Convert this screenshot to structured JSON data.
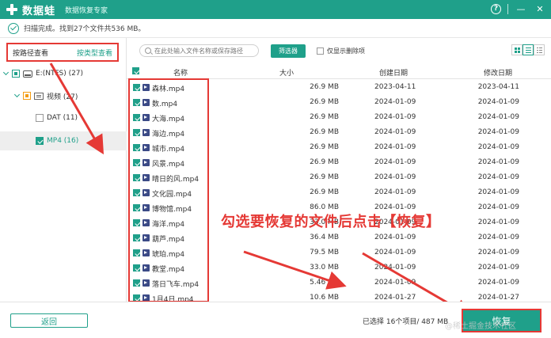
{
  "app": {
    "brand": "数据蛙",
    "subtitle": "数据恢复专家",
    "help_label": "?",
    "minimize_label": "—",
    "close_label": "✕"
  },
  "status": {
    "text": "扫描完成。找到27个文件共536 MB。"
  },
  "view_tabs": {
    "by_path": "按路径查看",
    "by_type": "按类型查看"
  },
  "tree": [
    {
      "label": "E:(NTFS) (27)"
    },
    {
      "label": "视频 (27)"
    },
    {
      "label": "DAT (11)"
    },
    {
      "label": "MP4 (16)"
    }
  ],
  "toolbar": {
    "search_placeholder": "在此处输入文件名称或保存路径",
    "filter_label": "筛选器",
    "only_deleted_label": "仅显示删除项"
  },
  "columns": {
    "name": "名称",
    "size": "大小",
    "created": "创建日期",
    "modified": "修改日期"
  },
  "files": [
    {
      "name": "森林.mp4",
      "size": "26.9 MB",
      "created": "2023-04-11",
      "modified": "2023-04-11"
    },
    {
      "name": "数.mp4",
      "size": "26.9 MB",
      "created": "2024-01-09",
      "modified": "2024-01-09"
    },
    {
      "name": "大海.mp4",
      "size": "26.9 MB",
      "created": "2024-01-09",
      "modified": "2024-01-09"
    },
    {
      "name": "海边.mp4",
      "size": "26.9 MB",
      "created": "2024-01-09",
      "modified": "2024-01-09"
    },
    {
      "name": "城市.mp4",
      "size": "26.9 MB",
      "created": "2024-01-09",
      "modified": "2024-01-09"
    },
    {
      "name": "风景.mp4",
      "size": "26.9 MB",
      "created": "2024-01-09",
      "modified": "2024-01-09"
    },
    {
      "name": "晴日的风.mp4",
      "size": "26.9 MB",
      "created": "2024-01-09",
      "modified": "2024-01-09"
    },
    {
      "name": "文化园.mp4",
      "size": "26.9 MB",
      "created": "2024-01-09",
      "modified": "2024-01-09"
    },
    {
      "name": "博物馆.mp4",
      "size": "86.0 MB",
      "created": "2024-01-09",
      "modified": "2024-01-09"
    },
    {
      "name": "海洋.mp4",
      "size": "33.0 MB",
      "created": "2024-01-09",
      "modified": "2024-01-09"
    },
    {
      "name": "葫芦.mp4",
      "size": "36.4 MB",
      "created": "2024-01-09",
      "modified": "2024-01-09"
    },
    {
      "name": "琥珀.mp4",
      "size": "79.5 MB",
      "created": "2024-01-09",
      "modified": "2024-01-09"
    },
    {
      "name": "教堂.mp4",
      "size": "33.0 MB",
      "created": "2024-01-09",
      "modified": "2024-01-09"
    },
    {
      "name": "落日飞车.mp4",
      "size": "5.46 MB",
      "created": "2024-01-09",
      "modified": "2024-01-09"
    },
    {
      "name": "1月4日.mp4",
      "size": "10.6 MB",
      "created": "2024-01-27",
      "modified": "2024-01-27"
    }
  ],
  "annotation": "勾选要恢复的文件后点击【恢复】",
  "footer": {
    "back_label": "返回",
    "selected_info": "已选择 16个项目/ 487 MB",
    "recover_label": "恢复",
    "watermark": "@稀土掘金技术社区"
  },
  "colors": {
    "accent": "#1fa08a",
    "highlight": "#e53935",
    "file_icon": "#3b4a86"
  }
}
